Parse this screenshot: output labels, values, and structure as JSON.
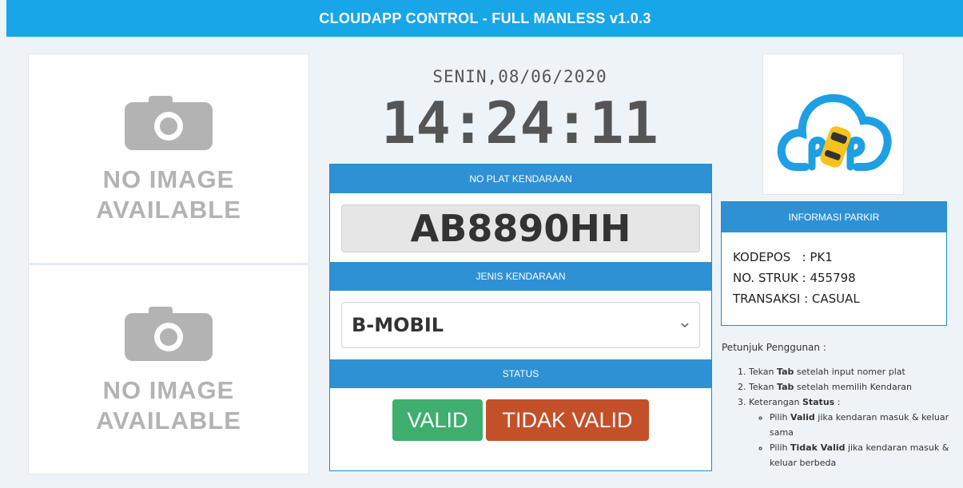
{
  "app": {
    "title": "CLOUDAPP CONTROL - FULL MANLESS v1.0.3"
  },
  "cameras": [
    {
      "placeholder_line1": "NO IMAGE",
      "placeholder_line2": "AVAILABLE",
      "icon": "camera-icon"
    },
    {
      "placeholder_line1": "NO IMAGE",
      "placeholder_line2": "AVAILABLE",
      "icon": "camera-icon"
    }
  ],
  "clock": {
    "date": "SENIN,08/06/2020",
    "time": "14:24:11"
  },
  "plate": {
    "header": "NO PLAT KENDARAAN",
    "value": "AB8890HH"
  },
  "vehicle_type": {
    "header": "JENIS KENDARAAN",
    "selected": "B-MOBIL"
  },
  "status": {
    "header": "STATUS",
    "valid_label": "VALID",
    "invalid_label": "TIDAK VALID"
  },
  "logo": {
    "icon": "cloud-parking-logo-icon"
  },
  "parking_info": {
    "header": "INFORMASI PARKIR",
    "kodepos": "KODEPOS   : PK1",
    "struk": "NO. STRUK : 455798",
    "transaksi": "TRANSAKSI : CASUAL"
  },
  "help": {
    "title": "Petunjuk Penggunan :",
    "step1_pre": "Tekan ",
    "step1_bold": "Tab",
    "step1_post": " setelah input nomer plat",
    "step2_pre": "Tekan ",
    "step2_bold": "Tab",
    "step2_post": " setelah memilih Kendaran",
    "step3_pre": "Keterangan ",
    "step3_bold": "Status",
    "step3_post": " :",
    "sub1_pre": "Pilih ",
    "sub1_bold": "Valid",
    "sub1_post": " jika kendaran masuk & keluar sama",
    "sub2_pre": "Pilih ",
    "sub2_bold": "Tidak Valid",
    "sub2_post": " jika kendaran masuk & keluar berbeda"
  },
  "colors": {
    "primary": "#17a6e8",
    "panel_head": "#2e91d4",
    "valid": "#3fae6e",
    "invalid": "#c4502a",
    "logo_yellow": "#f6c21d"
  }
}
